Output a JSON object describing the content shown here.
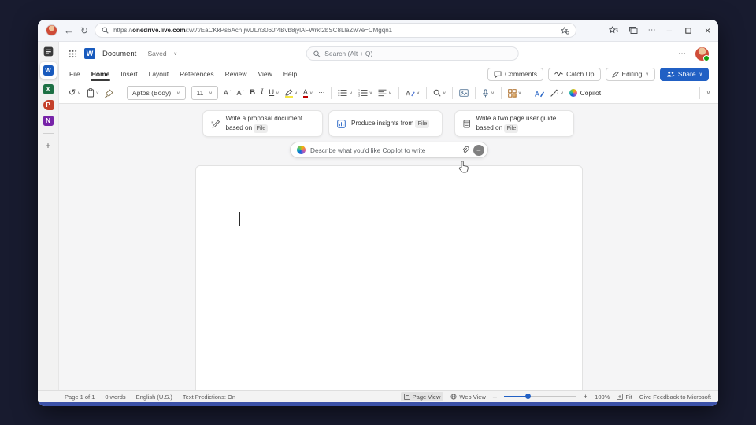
{
  "browser": {
    "url": {
      "scheme": "https://",
      "host": "onedrive.live.com",
      "path": "/:w:/t/EaCKkPs6AchIjwULn3060f4Bvb8jylAFWrkt2bSC8LlaZw?e=CMgqn1"
    },
    "back_glyph": "←",
    "refresh_glyph": "↻",
    "more_glyph": "⋯",
    "minimize_glyph": "─",
    "close_glyph": "×"
  },
  "app_header": {
    "title": "Document",
    "saved": "· Saved",
    "search_placeholder": "Search (Alt + Q)",
    "more_glyph": "⋯",
    "word_logo_letter": "W",
    "chevron_glyph": "∨"
  },
  "sidebar": {
    "word_letter": "W",
    "excel_letter": "X",
    "powerpoint_letter": "P",
    "onenote_letter": "N",
    "add_glyph": "+"
  },
  "menu": {
    "items": [
      "File",
      "Home",
      "Insert",
      "Layout",
      "References",
      "Review",
      "View",
      "Help"
    ]
  },
  "top_actions": {
    "comments": "Comments",
    "catch_up": "Catch Up",
    "editing": "Editing",
    "share": "Share"
  },
  "ribbon": {
    "undo_glyph": "↺",
    "font_name": "Aptos (Body)",
    "font_size": "11",
    "grow_letter": "A",
    "shrink_letter": "A",
    "bold": "B",
    "italic": "I",
    "underline": "U",
    "font_color_letter": "A",
    "more_glyph": "⋯",
    "copilot_label": "Copilot",
    "chevron_glyph": "∨"
  },
  "copilot": {
    "cards": [
      {
        "text": "Write a proposal document based on",
        "chip": "File"
      },
      {
        "text": "Produce insights from",
        "chip": "File"
      },
      {
        "text": "Write a two page user guide based on",
        "chip": "File"
      }
    ],
    "placeholder": "Describe what you'd like Copilot to write",
    "more_glyph": "⋯",
    "send_glyph": "→"
  },
  "status_bar": {
    "page": "Page 1 of 1",
    "words": "0 words",
    "language": "English (U.S.)",
    "predictions": "Text Predictions: On",
    "page_view": "Page View",
    "web_view": "Web View",
    "zoom_out_glyph": "–",
    "zoom_in_glyph": "+",
    "zoom_level": "100%",
    "fit": "Fit",
    "feedback": "Give Feedback to Microsoft"
  },
  "colors": {
    "accent_blue": "#2160c4",
    "word_blue": "#185abd",
    "excel_green": "#1d7044",
    "powerpoint_red": "#c4402a",
    "onenote_purple": "#7723a8",
    "strip_blue": "#3c52a8",
    "desktop_navy": "#181b2f"
  }
}
